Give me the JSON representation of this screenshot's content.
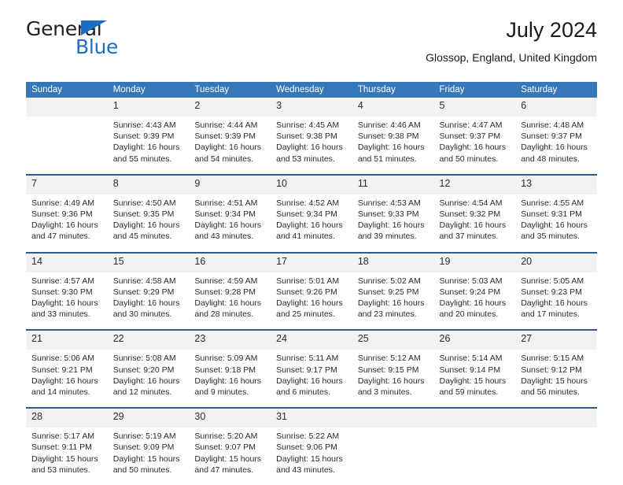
{
  "logo": {
    "word1": "General",
    "word2": "Blue",
    "triangle_color": "#1b6ec2"
  },
  "header": {
    "title": "July 2024",
    "subtitle": "Glossop, England, United Kingdom"
  },
  "theme": {
    "header_blue": "#3577b8",
    "rule_blue": "#2e5d8c",
    "daynum_band": "#f2f2f2"
  },
  "weekdays": [
    "Sunday",
    "Monday",
    "Tuesday",
    "Wednesday",
    "Thursday",
    "Friday",
    "Saturday"
  ],
  "weeks": [
    {
      "days": [
        {
          "num": "",
          "lines": []
        },
        {
          "num": "1",
          "lines": [
            "Sunrise: 4:43 AM",
            "Sunset: 9:39 PM",
            "Daylight: 16 hours",
            "and 55 minutes."
          ]
        },
        {
          "num": "2",
          "lines": [
            "Sunrise: 4:44 AM",
            "Sunset: 9:39 PM",
            "Daylight: 16 hours",
            "and 54 minutes."
          ]
        },
        {
          "num": "3",
          "lines": [
            "Sunrise: 4:45 AM",
            "Sunset: 9:38 PM",
            "Daylight: 16 hours",
            "and 53 minutes."
          ]
        },
        {
          "num": "4",
          "lines": [
            "Sunrise: 4:46 AM",
            "Sunset: 9:38 PM",
            "Daylight: 16 hours",
            "and 51 minutes."
          ]
        },
        {
          "num": "5",
          "lines": [
            "Sunrise: 4:47 AM",
            "Sunset: 9:37 PM",
            "Daylight: 16 hours",
            "and 50 minutes."
          ]
        },
        {
          "num": "6",
          "lines": [
            "Sunrise: 4:48 AM",
            "Sunset: 9:37 PM",
            "Daylight: 16 hours",
            "and 48 minutes."
          ]
        }
      ]
    },
    {
      "days": [
        {
          "num": "7",
          "lines": [
            "Sunrise: 4:49 AM",
            "Sunset: 9:36 PM",
            "Daylight: 16 hours",
            "and 47 minutes."
          ]
        },
        {
          "num": "8",
          "lines": [
            "Sunrise: 4:50 AM",
            "Sunset: 9:35 PM",
            "Daylight: 16 hours",
            "and 45 minutes."
          ]
        },
        {
          "num": "9",
          "lines": [
            "Sunrise: 4:51 AM",
            "Sunset: 9:34 PM",
            "Daylight: 16 hours",
            "and 43 minutes."
          ]
        },
        {
          "num": "10",
          "lines": [
            "Sunrise: 4:52 AM",
            "Sunset: 9:34 PM",
            "Daylight: 16 hours",
            "and 41 minutes."
          ]
        },
        {
          "num": "11",
          "lines": [
            "Sunrise: 4:53 AM",
            "Sunset: 9:33 PM",
            "Daylight: 16 hours",
            "and 39 minutes."
          ]
        },
        {
          "num": "12",
          "lines": [
            "Sunrise: 4:54 AM",
            "Sunset: 9:32 PM",
            "Daylight: 16 hours",
            "and 37 minutes."
          ]
        },
        {
          "num": "13",
          "lines": [
            "Sunrise: 4:55 AM",
            "Sunset: 9:31 PM",
            "Daylight: 16 hours",
            "and 35 minutes."
          ]
        }
      ]
    },
    {
      "days": [
        {
          "num": "14",
          "lines": [
            "Sunrise: 4:57 AM",
            "Sunset: 9:30 PM",
            "Daylight: 16 hours",
            "and 33 minutes."
          ]
        },
        {
          "num": "15",
          "lines": [
            "Sunrise: 4:58 AM",
            "Sunset: 9:29 PM",
            "Daylight: 16 hours",
            "and 30 minutes."
          ]
        },
        {
          "num": "16",
          "lines": [
            "Sunrise: 4:59 AM",
            "Sunset: 9:28 PM",
            "Daylight: 16 hours",
            "and 28 minutes."
          ]
        },
        {
          "num": "17",
          "lines": [
            "Sunrise: 5:01 AM",
            "Sunset: 9:26 PM",
            "Daylight: 16 hours",
            "and 25 minutes."
          ]
        },
        {
          "num": "18",
          "lines": [
            "Sunrise: 5:02 AM",
            "Sunset: 9:25 PM",
            "Daylight: 16 hours",
            "and 23 minutes."
          ]
        },
        {
          "num": "19",
          "lines": [
            "Sunrise: 5:03 AM",
            "Sunset: 9:24 PM",
            "Daylight: 16 hours",
            "and 20 minutes."
          ]
        },
        {
          "num": "20",
          "lines": [
            "Sunrise: 5:05 AM",
            "Sunset: 9:23 PM",
            "Daylight: 16 hours",
            "and 17 minutes."
          ]
        }
      ]
    },
    {
      "days": [
        {
          "num": "21",
          "lines": [
            "Sunrise: 5:06 AM",
            "Sunset: 9:21 PM",
            "Daylight: 16 hours",
            "and 14 minutes."
          ]
        },
        {
          "num": "22",
          "lines": [
            "Sunrise: 5:08 AM",
            "Sunset: 9:20 PM",
            "Daylight: 16 hours",
            "and 12 minutes."
          ]
        },
        {
          "num": "23",
          "lines": [
            "Sunrise: 5:09 AM",
            "Sunset: 9:18 PM",
            "Daylight: 16 hours",
            "and 9 minutes."
          ]
        },
        {
          "num": "24",
          "lines": [
            "Sunrise: 5:11 AM",
            "Sunset: 9:17 PM",
            "Daylight: 16 hours",
            "and 6 minutes."
          ]
        },
        {
          "num": "25",
          "lines": [
            "Sunrise: 5:12 AM",
            "Sunset: 9:15 PM",
            "Daylight: 16 hours",
            "and 3 minutes."
          ]
        },
        {
          "num": "26",
          "lines": [
            "Sunrise: 5:14 AM",
            "Sunset: 9:14 PM",
            "Daylight: 15 hours",
            "and 59 minutes."
          ]
        },
        {
          "num": "27",
          "lines": [
            "Sunrise: 5:15 AM",
            "Sunset: 9:12 PM",
            "Daylight: 15 hours",
            "and 56 minutes."
          ]
        }
      ]
    },
    {
      "days": [
        {
          "num": "28",
          "lines": [
            "Sunrise: 5:17 AM",
            "Sunset: 9:11 PM",
            "Daylight: 15 hours",
            "and 53 minutes."
          ]
        },
        {
          "num": "29",
          "lines": [
            "Sunrise: 5:19 AM",
            "Sunset: 9:09 PM",
            "Daylight: 15 hours",
            "and 50 minutes."
          ]
        },
        {
          "num": "30",
          "lines": [
            "Sunrise: 5:20 AM",
            "Sunset: 9:07 PM",
            "Daylight: 15 hours",
            "and 47 minutes."
          ]
        },
        {
          "num": "31",
          "lines": [
            "Sunrise: 5:22 AM",
            "Sunset: 9:06 PM",
            "Daylight: 15 hours",
            "and 43 minutes."
          ]
        },
        {
          "num": "",
          "lines": []
        },
        {
          "num": "",
          "lines": []
        },
        {
          "num": "",
          "lines": []
        }
      ]
    }
  ]
}
